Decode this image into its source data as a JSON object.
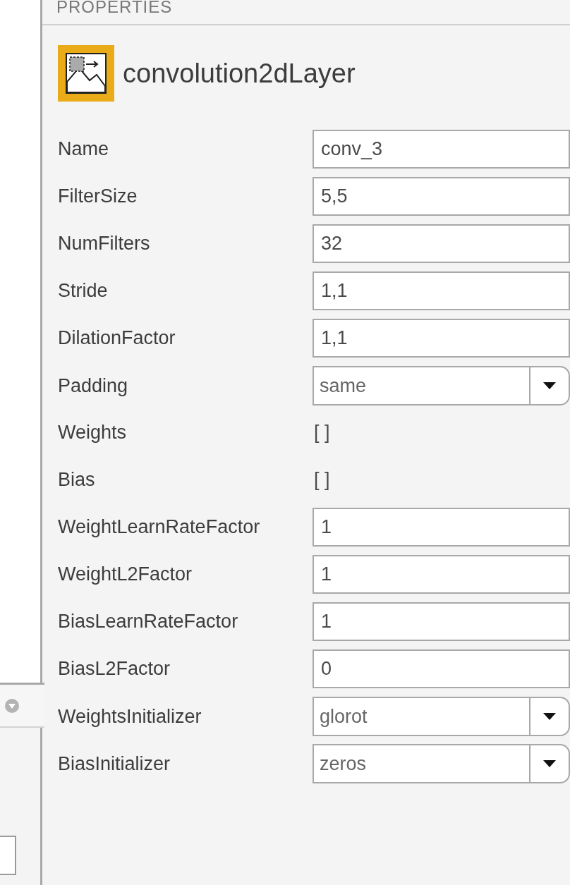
{
  "panel": {
    "title": "PROPERTIES",
    "layer_name": "convolution2dLayer"
  },
  "properties": [
    {
      "label": "Name",
      "kind": "text",
      "value": "conv_3"
    },
    {
      "label": "FilterSize",
      "kind": "text",
      "value": "5,5"
    },
    {
      "label": "NumFilters",
      "kind": "text",
      "value": "32"
    },
    {
      "label": "Stride",
      "kind": "text",
      "value": "1,1"
    },
    {
      "label": "DilationFactor",
      "kind": "text",
      "value": "1,1"
    },
    {
      "label": "Padding",
      "kind": "dropdown",
      "value": "same"
    },
    {
      "label": "Weights",
      "kind": "readonly",
      "value": "[ ]"
    },
    {
      "label": "Bias",
      "kind": "readonly",
      "value": "[ ]"
    },
    {
      "label": "WeightLearnRateFactor",
      "kind": "text",
      "value": "1"
    },
    {
      "label": "WeightL2Factor",
      "kind": "text",
      "value": "1"
    },
    {
      "label": "BiasLearnRateFactor",
      "kind": "text",
      "value": "1"
    },
    {
      "label": "BiasL2Factor",
      "kind": "text",
      "value": "0"
    },
    {
      "label": "WeightsInitializer",
      "kind": "dropdown",
      "value": "glorot"
    },
    {
      "label": "BiasInitializer",
      "kind": "dropdown",
      "value": "zeros"
    }
  ]
}
